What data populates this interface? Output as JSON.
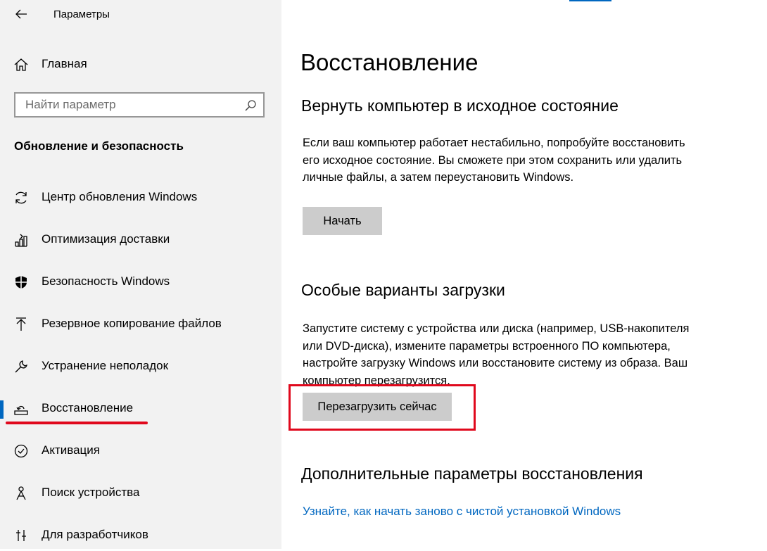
{
  "window": {
    "title": "Параметры"
  },
  "sidebar": {
    "home_label": "Главная",
    "search_placeholder": "Найти параметр",
    "section_title": "Обновление и безопасность",
    "items": [
      {
        "label": "Центр обновления Windows",
        "icon": "refresh-icon"
      },
      {
        "label": "Оптимизация доставки",
        "icon": "delivery-optimization-icon"
      },
      {
        "label": "Безопасность Windows",
        "icon": "shield-icon"
      },
      {
        "label": "Резервное копирование файлов",
        "icon": "upload-arrow-icon"
      },
      {
        "label": "Устранение неполадок",
        "icon": "wrench-icon"
      },
      {
        "label": "Восстановление",
        "icon": "recovery-icon",
        "active": true
      },
      {
        "label": "Активация",
        "icon": "check-circle-icon"
      },
      {
        "label": "Поиск устройства",
        "icon": "find-device-icon"
      },
      {
        "label": "Для разработчиков",
        "icon": "developer-tools-icon"
      }
    ]
  },
  "main": {
    "title": "Восстановление",
    "reset": {
      "heading": "Вернуть компьютер в исходное состояние",
      "description": "Если ваш компьютер работает нестабильно, попробуйте восстановить его исходное состояние. Вы сможете при этом сохранить или удалить личные файлы, а затем переустановить Windows.",
      "button": "Начать"
    },
    "advanced_startup": {
      "heading": "Особые варианты загрузки",
      "description": "Запустите систему с устройства или диска (например, USB-накопителя или DVD-диска), измените параметры встроенного ПО компьютера, настройте загрузку Windows или восстановите систему из образа. Ваш компьютер перезагрузится.",
      "button": "Перезагрузить сейчас"
    },
    "more_options": {
      "heading": "Дополнительные параметры восстановления",
      "link": "Узнайте, как начать заново с чистой установкой Windows"
    }
  },
  "colors": {
    "accent": "#0067c0",
    "annotation_red": "#e0081c",
    "sidebar_bg": "#f2f2f2",
    "button_bg": "#cccccc"
  }
}
